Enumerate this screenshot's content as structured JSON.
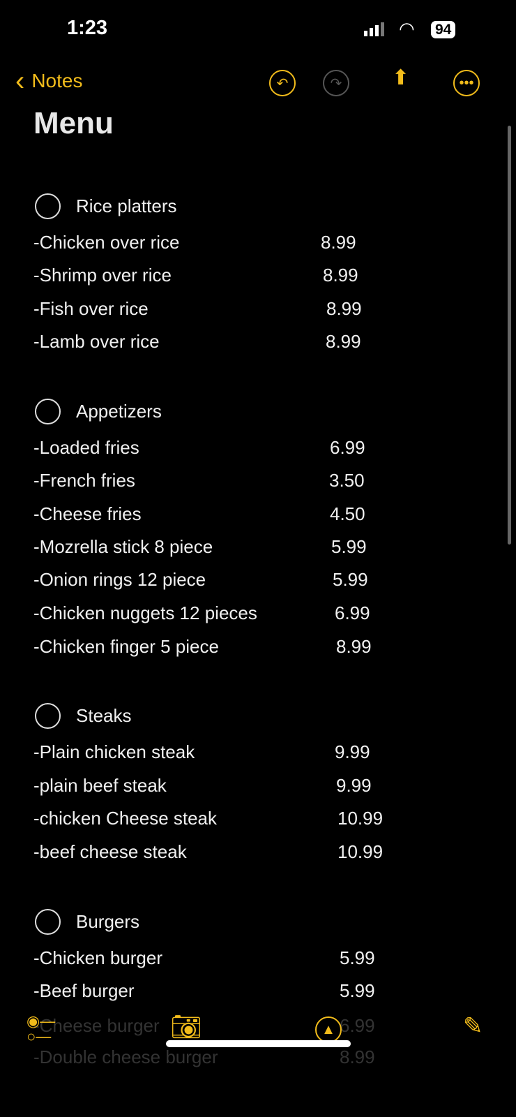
{
  "status": {
    "time": "1:23",
    "battery": "94"
  },
  "nav": {
    "back_label": "Notes"
  },
  "note": {
    "title": "Menu",
    "sections": [
      {
        "heading": "Rice platters",
        "items": [
          [
            "-Chicken over rice",
            "8.99"
          ],
          [
            "-Shrimp over rice",
            "8.99"
          ],
          [
            "-Fish over rice",
            "8.99"
          ],
          [
            "-Lamb over rice",
            "8.99"
          ]
        ]
      },
      {
        "heading": "Appetizers",
        "items": [
          [
            "-Loaded fries",
            "6.99"
          ],
          [
            "-French fries",
            "3.50"
          ],
          [
            "-Cheese fries",
            "4.50"
          ],
          [
            "-Mozrella stick 8 piece",
            "5.99"
          ],
          [
            "-Onion rings 12 piece",
            "5.99"
          ],
          [
            "-Chicken nuggets 12 pieces",
            "6.99"
          ],
          [
            "-Chicken finger 5 piece",
            "8.99"
          ]
        ]
      },
      {
        "heading": "Steaks",
        "items": [
          [
            "-Plain chicken steak",
            "9.99"
          ],
          [
            "-plain beef steak",
            "9.99"
          ],
          [
            "-chicken Cheese steak",
            "10.99"
          ],
          [
            "-beef cheese steak",
            "10.99"
          ]
        ]
      },
      {
        "heading": "Burgers",
        "items": [
          [
            "-Chicken burger",
            "5.99"
          ],
          [
            "-Beef burger",
            "5.99"
          ],
          [
            "-Cheese burger",
            "6.99"
          ],
          [
            "-Double cheese burger",
            "8.99"
          ]
        ]
      }
    ]
  },
  "colors": {
    "accent": "#f2bc1b",
    "background": "#000000"
  }
}
